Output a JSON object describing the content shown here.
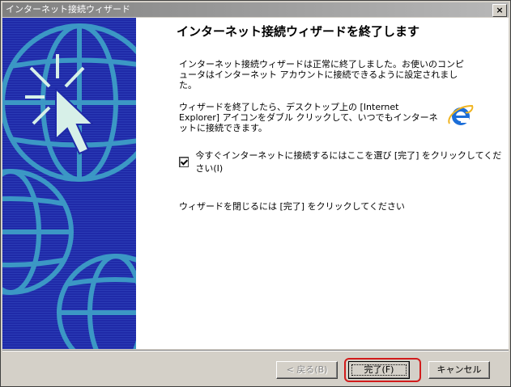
{
  "window": {
    "title": "インターネット接続ウィザード",
    "close_label": "×"
  },
  "main": {
    "heading": "インターネット接続ウィザードを終了します",
    "paragraph1": "インターネット接続ウィザードは正常に終了しました。お使いのコンピュータはインターネット アカウントに接続できるように設定されました。",
    "paragraph2": "ウィザードを終了したら、デスクトップ上の [Internet Explorer] アイコンをダブル クリックして、いつでもインターネットに接続できます。",
    "checkbox_label": "今すぐインターネットに接続するにはここを選び [完了] をクリックしてください(I)",
    "checkbox_checked": true,
    "paragraph3": "ウィザードを閉じるには [完了] をクリックしてください"
  },
  "footer": {
    "back_label": "< 戻る(B)",
    "finish_label": "完了(F)",
    "cancel_label": "キャンセル"
  },
  "colors": {
    "sidebar_blue": "#1f2aa8",
    "globe_cyan": "#3fa3c8",
    "highlight_red": "#d11b1b"
  }
}
